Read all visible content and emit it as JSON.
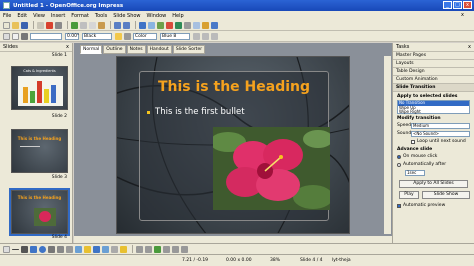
{
  "window": {
    "title": "Untitled 1 - OpenOffice.org Impress",
    "controls": [
      "_",
      "□",
      "x"
    ]
  },
  "menu": [
    "File",
    "Edit",
    "View",
    "Insert",
    "Format",
    "Tools",
    "Slide Show",
    "Window",
    "Help"
  ],
  "menu_close": "x",
  "toolbar2": {
    "zoom": "0.00\"",
    "line_color": "Black",
    "area_mode": "Color",
    "area_color": "Blue 8"
  },
  "slides_panel": {
    "title": "Slides",
    "close": "x",
    "thumbs": [
      {
        "label": "Slide 1",
        "heading": ""
      },
      {
        "label": "Slide 2",
        "heading": "Cats & Ingredients"
      },
      {
        "label": "Slide 3",
        "heading": "This is the Heading"
      },
      {
        "label": "Slide 4",
        "heading": "This is the Heading"
      }
    ]
  },
  "view_tabs": [
    "Normal",
    "Outline",
    "Notes",
    "Handout",
    "Slide Sorter"
  ],
  "slide": {
    "heading": "This is the Heading",
    "bullet": "This is the first bullet"
  },
  "tasks": {
    "title": "Tasks",
    "close": "x",
    "sections": [
      "Master Pages",
      "Layouts",
      "Table Design",
      "Custom Animation",
      "Slide Transition"
    ],
    "apply_label": "Apply to selected slides",
    "transitions": [
      "No Transition",
      "Wipe Up",
      "Wipe Right"
    ],
    "modify_label": "Modify transition",
    "speed_label": "Speed",
    "speed_value": "Medium",
    "sound_label": "Sound",
    "sound_value": "<No Sound>",
    "loop_label": "Loop until next sound",
    "advance_label": "Advance slide",
    "on_click": "On mouse click",
    "auto_after": "Automatically after",
    "auto_value": "1sec",
    "apply_all": "Apply to All Slides",
    "play": "Play",
    "slide_show": "Slide Show",
    "auto_preview": "Automatic preview"
  },
  "status": {
    "position": "7.21 / -0.19",
    "size": "0.00 x 0.00",
    "slide": "Slide 4 / 4",
    "master": "lyt-theja",
    "zoom": "38%"
  }
}
